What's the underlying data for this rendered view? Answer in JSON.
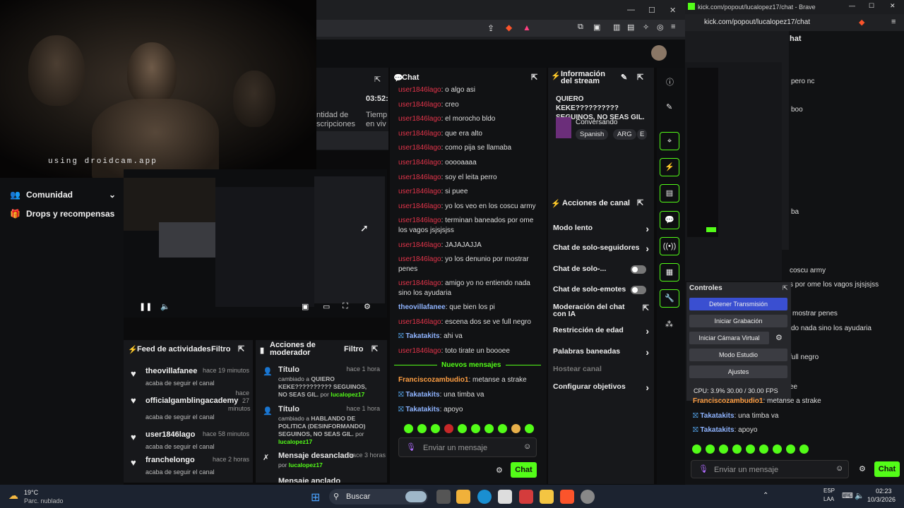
{
  "webcam": {
    "watermark": "using droidcam.app"
  },
  "browser": {
    "url": "kick.com/popout/lucalopez17/chat - Brave",
    "url_short": "kick.com/popout/lucalopez17/chat"
  },
  "nav": {
    "items": [
      {
        "label": "Comunidad"
      },
      {
        "label": "Drops y recompensas"
      }
    ]
  },
  "analytics": {
    "time": "03:52:",
    "label1": "ntidad de",
    "label1b": "scripciones",
    "label2": "Tiemp",
    "label2b": "en viv"
  },
  "feed": {
    "title": "Feed de actividades",
    "filter": "Filtro",
    "items": [
      {
        "name": "theovillafanee",
        "time": "hace 19 minutos",
        "action": "acaba de seguir el canal"
      },
      {
        "name": "officialgamblingacademy",
        "time": "hace 27 minutos",
        "action": "acaba de seguir el canal"
      },
      {
        "name": "user1846lago",
        "time": "hace 58 minutos",
        "action": "acaba de seguir el canal"
      },
      {
        "name": "franchelongo",
        "time": "hace 2 horas",
        "action": "acaba de seguir el canal"
      }
    ]
  },
  "mod": {
    "title": "Acciones de moderador",
    "filter": "Filtro",
    "items": [
      {
        "title": "Título",
        "time": "hace 1 hora",
        "changed": "cambiado a",
        "value": "QUIERO KEKE?????????? SEGUINOS, NO SEAS GIL.",
        "by": "por",
        "user": "lucalopez17"
      },
      {
        "title": "Título",
        "time": "hace 1 hora",
        "changed": "cambiado a",
        "value": "HABLANDO DE POLITICA (DESINFORMANDO) SEGUINOS, NO SEAS GIL.",
        "by": "por",
        "user": "lucalopez17"
      },
      {
        "title": "Mensaje desanclado",
        "time": "hace 3 horas",
        "by": "por",
        "user": "lucalopez17"
      },
      {
        "title": "Mensaje anclado"
      }
    ]
  },
  "chat": {
    "title": "Chat",
    "messages": [
      {
        "user": "user1846lago",
        "text": "o algo asi"
      },
      {
        "user": "user1846lago",
        "text": "creo"
      },
      {
        "user": "user1846lago",
        "text": "el morocho bldo"
      },
      {
        "user": "user1846lago",
        "text": "que era alto"
      },
      {
        "user": "user1846lago",
        "text": "como pija se llamaba"
      },
      {
        "user": "user1846lago",
        "text": "ooooaaaa"
      },
      {
        "user": "user1846lago",
        "text": "soy el leita perro"
      },
      {
        "user": "user1846lago",
        "text": "si puee"
      },
      {
        "user": "user1846lago",
        "text": "yo los veo en los coscu army"
      },
      {
        "user": "user1846lago",
        "text": "terminan baneados por ome los vagos jsjsjsjss"
      },
      {
        "user": "user1846lago",
        "text": "JAJAJAJJA"
      },
      {
        "user": "user1846lago",
        "text": "yo los denunio por mostrar penes"
      },
      {
        "user": "user1846lago",
        "text": "amigo yo no entiendo nada sino los ayudaria"
      },
      {
        "user": "theovillafanee",
        "text": "que bien los pi"
      },
      {
        "user": "user1846lago",
        "text": "escena dos se ve full negro"
      },
      {
        "user": "Takatakits",
        "text": "ahi va"
      },
      {
        "user": "user1846lago",
        "text": "toto tirate un boooee"
      }
    ],
    "new_label": "Nuevos mensajes",
    "new_messages": [
      {
        "user": "Franciscozambudio1",
        "text": "metanse a strake"
      },
      {
        "user": "Takatakits",
        "text": "una timba va"
      },
      {
        "user": "Takatakits",
        "text": "apoyo"
      }
    ],
    "placeholder": "Enviar un mensaje",
    "send": "Chat"
  },
  "info": {
    "title": "Información del stream",
    "stream_title": "QUIERO KEKE?????????? SEGUINOS, NO SEAS GIL.",
    "category": "Conversando",
    "tags": [
      "Spanish",
      "ARG",
      "E"
    ]
  },
  "actions": {
    "title": "Acciones de canal",
    "items": [
      "Modo lento",
      "Chat de solo-seguidores",
      "Chat de solo-...",
      "Chat de solo-emotes",
      "Moderación del chat con IA",
      "Restricción de edad",
      "Palabras baneadas",
      "Hostear canal",
      "Configurar objetivos"
    ]
  },
  "popout": {
    "snippets": [
      "pero nc",
      "boo",
      "ba",
      "coscu army",
      "s por ome los vagos jsjsjsjss",
      "mostrar penes",
      "do nada sino los ayudaria",
      "full negro",
      "ee"
    ],
    "controls_title": "Controles",
    "buttons": [
      "Detener Transmisión",
      "Iniciar Grabación",
      "Iniciar Cámara Virtual",
      "Modo Estudio",
      "Ajustes"
    ],
    "stats": "CPU: 3.9%   30.00 / 30.00 FPS",
    "messages": [
      {
        "user": "Franciscozambudio1",
        "text": "metanse a strake"
      },
      {
        "user": "Takatakits",
        "text": "una timba va"
      },
      {
        "user": "Takatakits",
        "text": "apoyo"
      }
    ],
    "placeholder": "Enviar un mensaje",
    "send": "Chat",
    "title_frag": "hat"
  },
  "taskbar": {
    "temp": "19°C",
    "weather": "Parc. nublado",
    "search": "Buscar",
    "lang": "ESP",
    "lang2": "LAA",
    "time": "02:23",
    "date": "10/3/2026"
  },
  "colors": {
    "accent": "#53fc18",
    "username": "#e3344a"
  }
}
